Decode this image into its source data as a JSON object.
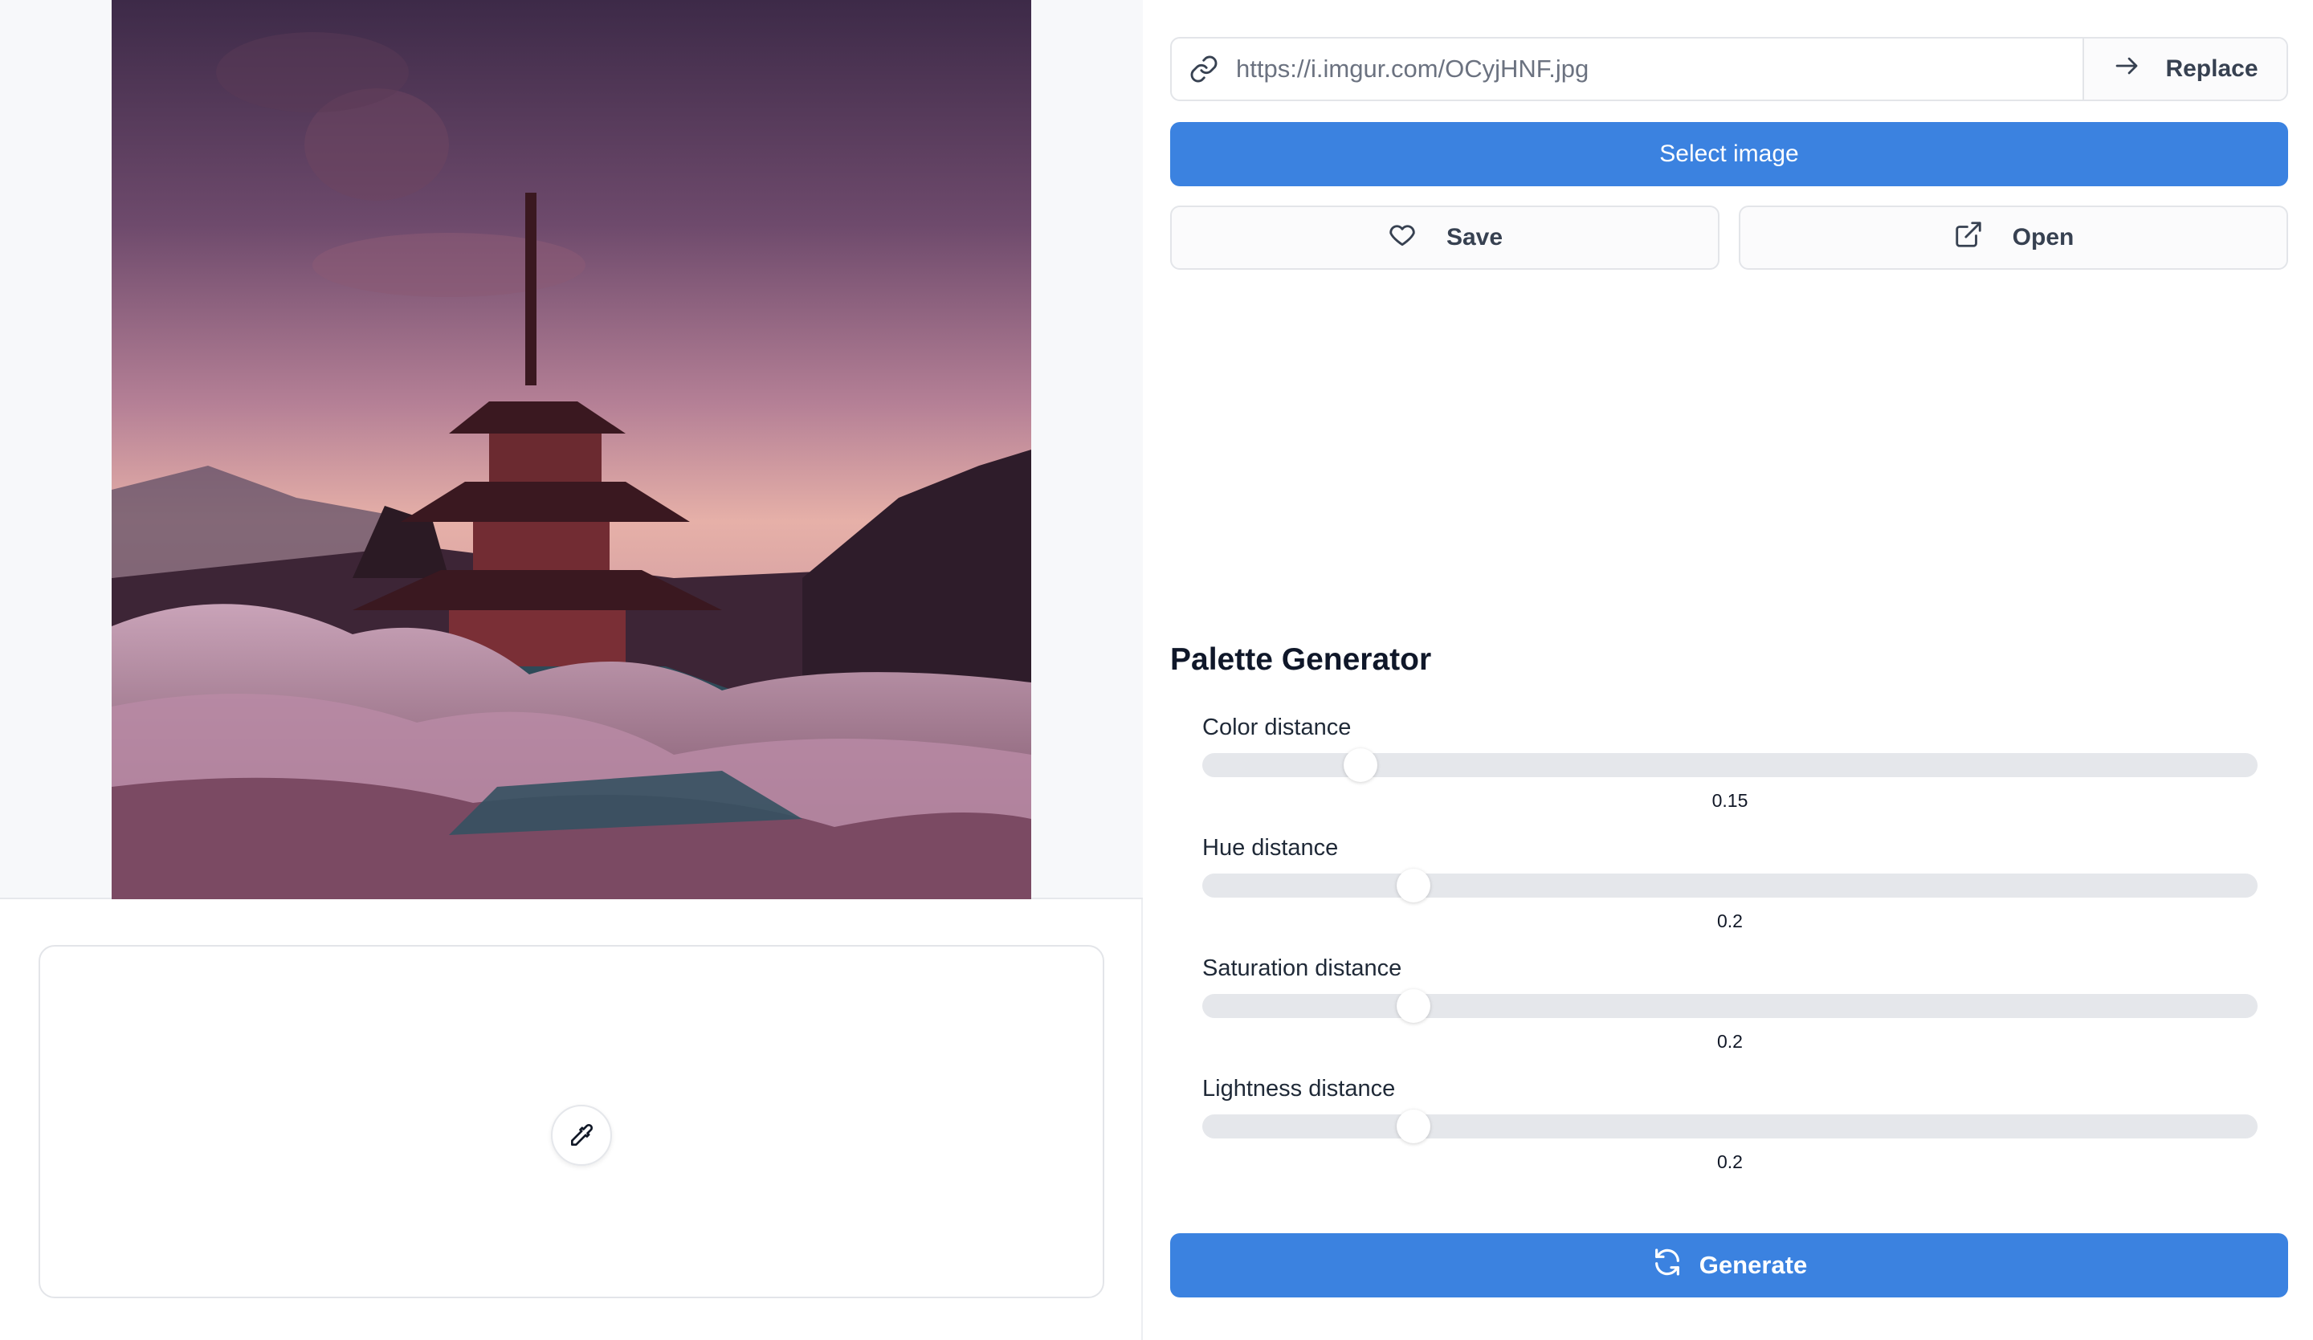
{
  "url_bar": {
    "value": "https://i.imgur.com/OCyjHNF.jpg",
    "replace_label": "Replace"
  },
  "select_label": "Select image",
  "actions": {
    "save_label": "Save",
    "open_label": "Open"
  },
  "palette": {
    "title": "Palette Generator",
    "sliders": [
      {
        "label": "Color distance",
        "value": "0.15",
        "fraction": 0.15
      },
      {
        "label": "Hue distance",
        "value": "0.2",
        "fraction": 0.2
      },
      {
        "label": "Saturation distance",
        "value": "0.2",
        "fraction": 0.2
      },
      {
        "label": "Lightness distance",
        "value": "0.2",
        "fraction": 0.2
      }
    ],
    "generate_label": "Generate"
  },
  "icons": {
    "url": "link-icon",
    "replace": "arrow-right-icon",
    "save": "heart-icon",
    "open": "external-link-icon",
    "generate": "refresh-icon",
    "picker": "eyedropper-icon"
  },
  "colors": {
    "primary": "#3b82e0",
    "slider_track": "#e5e7eb",
    "left_background": "#f7f8fa"
  }
}
